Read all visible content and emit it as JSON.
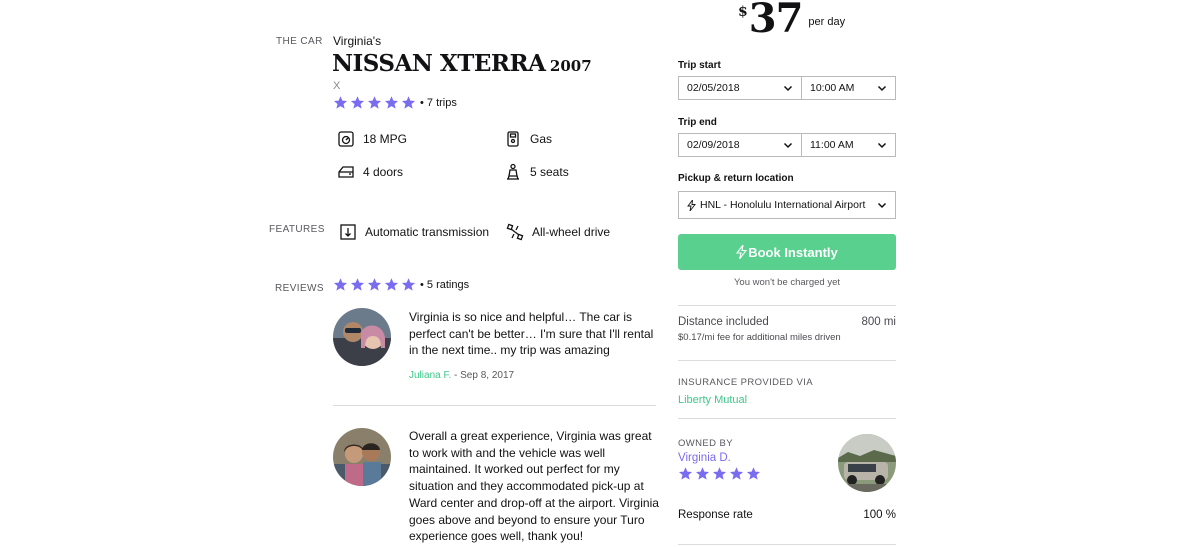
{
  "car": {
    "section_label": "THE CAR",
    "owner_name": "Virginia's",
    "make_model": "NISSAN XTERRA",
    "year": "2007",
    "trim": "X",
    "rating_stars": 5,
    "trips": "• 7 trips"
  },
  "specs": [
    {
      "icon": "fuel-gauge-icon",
      "label": "18 MPG"
    },
    {
      "icon": "gas-pump-icon",
      "label": "Gas"
    },
    {
      "icon": "car-door-icon",
      "label": "4 doors"
    },
    {
      "icon": "car-seat-icon",
      "label": "5 seats"
    }
  ],
  "features": {
    "section_label": "FEATURES",
    "items": [
      {
        "icon": "transmission-icon",
        "label": "Automatic transmission"
      },
      {
        "icon": "all-wheel-drive-icon",
        "label": "All-wheel drive"
      }
    ]
  },
  "reviews": {
    "section_label": "REVIEWS",
    "rating_stars": 5,
    "ratings_count": "• 5 ratings",
    "items": [
      {
        "text": "Virginia is so nice and helpful… The car is perfect can't be better… I'm sure that I'll rental in the next time.. my trip was amazing",
        "reviewer": "Juliana F.",
        "date": " - Sep 8, 2017"
      },
      {
        "text": "Overall a great experience, Virginia was great to work with and the vehicle was well maintained. It worked out perfect for my situation and they accommodated pick-up at Ward center and drop-off at the airport. Virginia goes above and beyond to ensure your Turo experience goes well, thank you!"
      }
    ]
  },
  "booking": {
    "currency": "$",
    "price": "37",
    "per_day": "per day",
    "trip_start_label": "Trip start",
    "trip_start_date": "02/05/2018",
    "trip_start_time": "10:00 AM",
    "trip_end_label": "Trip end",
    "trip_end_date": "02/09/2018",
    "trip_end_time": "11:00 AM",
    "location_label": "Pickup & return location",
    "location_value": "HNL - Honolulu International Airport",
    "book_label": "Book Instantly",
    "charge_note": "You won't be charged yet"
  },
  "distance": {
    "label": "Distance included",
    "value": "800 mi",
    "fee_note": "$0.17/mi fee for additional miles driven"
  },
  "insurance": {
    "label": "INSURANCE PROVIDED VIA",
    "provider": "Liberty Mutual"
  },
  "owner": {
    "label": "OWNED BY",
    "name": "Virginia D.",
    "rating_stars": 5,
    "response_rate_label": "Response rate",
    "response_rate_value": "100 %"
  },
  "colors": {
    "accent_purple": "#7a6cf0",
    "accent_green": "#59d08e",
    "link_green": "#3fc78a"
  }
}
